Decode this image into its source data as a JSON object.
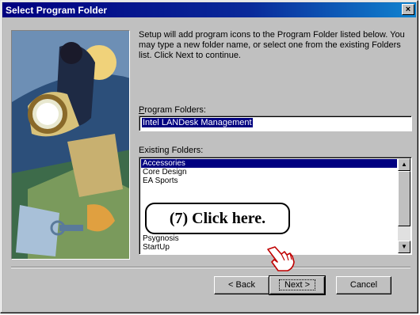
{
  "window": {
    "title": "Select Program Folder",
    "close_glyph": "×"
  },
  "description": "Setup will add program icons to the Program Folder listed below. You may type a new folder name, or select one from the existing Folders list.  Click Next to continue.",
  "program_folders": {
    "label": "Program Folders:",
    "value": "Intel LANDesk Management"
  },
  "existing_folders": {
    "label": "Existing Folders:",
    "items_top": [
      "Accessories",
      "Core Design",
      "EA Sports"
    ],
    "selected": "Accessories",
    "items_bottom": [
      "Psygnosis",
      "StartUp"
    ]
  },
  "buttons": {
    "back": "< Back",
    "next": "Next >",
    "cancel": "Cancel"
  },
  "callout": {
    "text": "(7)  Click here."
  },
  "icons": {
    "pointer": "hand-pointer-icon",
    "scroll_up": "arrow-up-icon",
    "scroll_down": "arrow-down-icon"
  },
  "colors": {
    "title_bar": "#000080",
    "selection": "#000080",
    "dialog_face": "#c0c0c0"
  }
}
